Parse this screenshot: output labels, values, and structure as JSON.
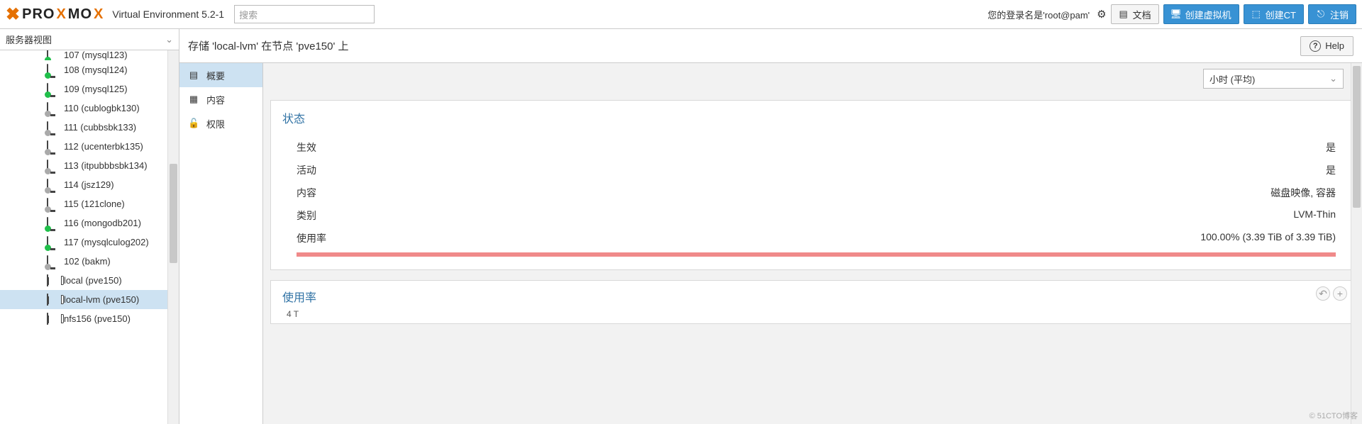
{
  "topbar": {
    "brand": "PROXMOX",
    "env_label": "Virtual Environment 5.2-1",
    "search_placeholder": "搜索",
    "login_text": "您的登录名是'root@pam'",
    "doc_label": "文档",
    "create_vm_label": "创建虚拟机",
    "create_ct_label": "创建CT",
    "logout_label": "注销"
  },
  "sidebar": {
    "view_label": "服务器视图",
    "items": [
      {
        "label": "107 (mysql123)",
        "icon": "mon",
        "state": "green"
      },
      {
        "label": "108 (mysql124)",
        "icon": "mon",
        "state": "green"
      },
      {
        "label": "109 (mysql125)",
        "icon": "mon",
        "state": "green"
      },
      {
        "label": "110 (cublogbk130)",
        "icon": "mon",
        "state": "gray"
      },
      {
        "label": "111 (cubbsbk133)",
        "icon": "mon",
        "state": "gray"
      },
      {
        "label": "112 (ucenterbk135)",
        "icon": "mon",
        "state": "gray"
      },
      {
        "label": "113 (itpubbbsbk134)",
        "icon": "mon",
        "state": "gray"
      },
      {
        "label": "114 (jsz129)",
        "icon": "mon",
        "state": "gray"
      },
      {
        "label": "115 (121clone)",
        "icon": "mon",
        "state": "gray"
      },
      {
        "label": "116 (mongodb201)",
        "icon": "mon",
        "state": "green"
      },
      {
        "label": "117 (mysqlculog202)",
        "icon": "mon",
        "state": "green"
      },
      {
        "label": "102 (bakm)",
        "icon": "mon",
        "state": "gray"
      },
      {
        "label": "local (pve150)",
        "icon": "db",
        "state": ""
      },
      {
        "label": "local-lvm (pve150)",
        "icon": "db",
        "state": "selected"
      },
      {
        "label": "nfs156 (pve150)",
        "icon": "db",
        "state": ""
      }
    ]
  },
  "content": {
    "title": "存储 'local-lvm' 在节点 'pve150' 上",
    "help_label": "Help",
    "time_range": "小时 (平均)",
    "subtabs": [
      {
        "label": "概要",
        "icon": "book",
        "selected": true
      },
      {
        "label": "内容",
        "icon": "grid",
        "selected": false
      },
      {
        "label": "权限",
        "icon": "lock",
        "selected": false
      }
    ],
    "status_panel": {
      "title": "状态",
      "rows": [
        {
          "key": "生效",
          "value": "是"
        },
        {
          "key": "活动",
          "value": "是"
        },
        {
          "key": "内容",
          "value": "磁盘映像, 容器"
        },
        {
          "key": "类别",
          "value": "LVM-Thin"
        }
      ],
      "usage_key": "使用率",
      "usage_value": "100.00% (3.39 TiB of 3.39 TiB)",
      "usage_pct": 100
    },
    "usage_panel": {
      "title": "使用率",
      "y_axis_top": "4 T"
    }
  },
  "watermark": "© 51CTO博客"
}
